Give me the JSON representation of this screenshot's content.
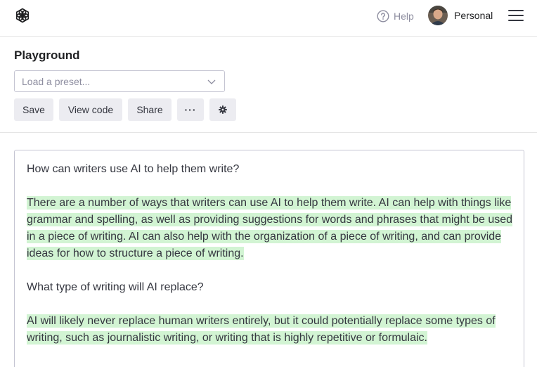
{
  "header": {
    "help_label": "Help",
    "account_label": "Personal"
  },
  "page": {
    "title": "Playground"
  },
  "preset": {
    "placeholder": "Load a preset..."
  },
  "toolbar": {
    "save_label": "Save",
    "view_code_label": "View code",
    "share_label": "Share",
    "more_label": "···"
  },
  "icons": {
    "logo": "openai-logo-icon",
    "help": "question-circle-icon",
    "menu": "hamburger-menu-icon",
    "settings": "gear-icon",
    "chevron": "chevron-down-icon"
  },
  "colors": {
    "completion_highlight": "#d2f4d3",
    "button_bg": "#ececf1"
  },
  "editor": {
    "prompt_1": "How can writers use AI to help them write?",
    "completion_1": "There are a number of ways that writers can use AI to help them write. AI can help with things like grammar and spelling, as well as providing suggestions for words and phrases that  might be used in a piece of writing. AI can also help with the organization of a piece of writing, and can provide ideas for how to structure a piece of writing.",
    "prompt_2": "What type of writing will AI replace?",
    "completion_2": "AI will likely never replace human writers entirely, but it could potentially replace some types of writing, such as journalistic writing, or writing that is highly repetitive or formulaic."
  }
}
